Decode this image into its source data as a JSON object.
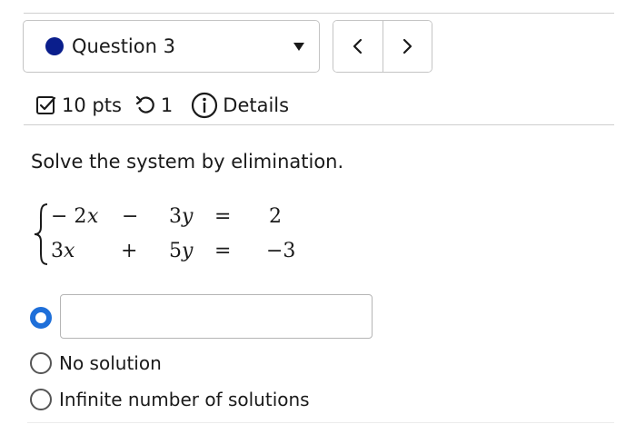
{
  "header": {
    "question_label": "Question 3",
    "question_status_color": "#0a1e8c",
    "prev_icon": "chevron-left-icon",
    "next_icon": "chevron-right-icon"
  },
  "meta": {
    "points": "10 pts",
    "attempts": "1",
    "details": "Details",
    "icons": [
      "checkbox-checked-icon",
      "undo-icon",
      "info-icon"
    ]
  },
  "problem": {
    "prompt": "Solve the system by elimination.",
    "system": {
      "row1": {
        "a": "− 2",
        "x": "x",
        "op": "−",
        "b": "3",
        "y": "y",
        "eq": "=",
        "rhs": "2"
      },
      "row2": {
        "a": "3",
        "x": "x",
        "op": "+",
        "b": "5",
        "y": "y",
        "eq": "=",
        "rhs": "−3"
      }
    }
  },
  "choices": {
    "selected_color": "#1e6fd9",
    "answer_value": "",
    "no_solution": "No solution",
    "infinite": "Infinite number of solutions"
  }
}
